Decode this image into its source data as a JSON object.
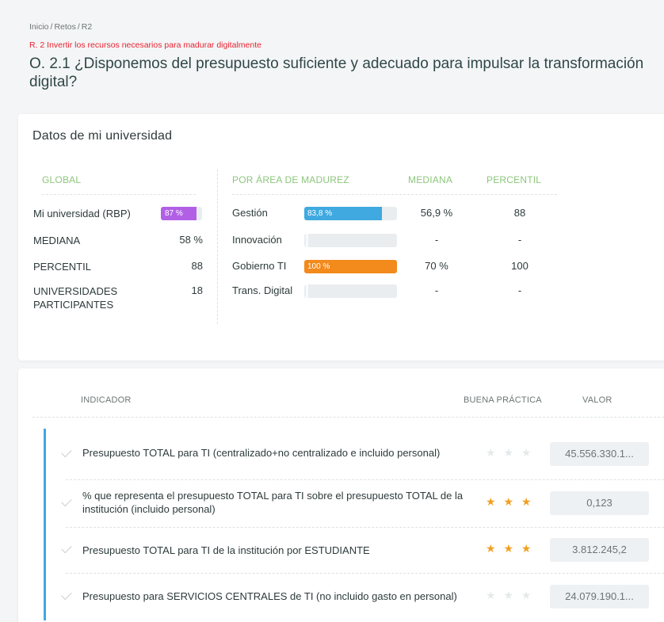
{
  "breadcrumb": {
    "items": [
      "Inicio",
      "Retos",
      "R2"
    ],
    "separator": "/"
  },
  "reto": "R. 2 Invertir los recursos necesarios para madurar digitalmente",
  "title": "O. 2.1 ¿Disponemos del presupuesto suficiente y adecuado para impulsar la transformación digital?",
  "card1": {
    "title": "Datos de mi universidad",
    "headers": {
      "global": "GLOBAL",
      "area": "POR ÁREA DE MADUREZ",
      "mediana": "MEDIANA",
      "percentil": "PERCENTIL"
    },
    "global": {
      "uni_label": "Mi universidad (RBP)",
      "uni_value": "87 %",
      "uni_fraction": 0.87,
      "mediana_label": "MEDIANA",
      "mediana_value": "58 %",
      "percentil_label": "PERCENTIL",
      "percentil_value": "88",
      "participantes_label": "UNIVERSIDADES PARTICIPANTES",
      "participantes_value": "18"
    },
    "areas": [
      {
        "label": "Gestión",
        "bar_text": "83,8 %",
        "fraction": 0.838,
        "color": "#3fa9e0",
        "mediana": "56,9 %",
        "percentil": "88"
      },
      {
        "label": "Innovación",
        "bar_text": "",
        "fraction": 0,
        "color": "#3fa9e0",
        "mediana": "-",
        "percentil": "-"
      },
      {
        "label": "Gobierno TI",
        "bar_text": "100 %",
        "fraction": 1.0,
        "color": "#f28a1c",
        "mediana": "70 %",
        "percentil": "100"
      },
      {
        "label": "Trans. Digital",
        "bar_text": "",
        "fraction": 0,
        "color": "#3fa9e0",
        "mediana": "-",
        "percentil": "-"
      }
    ]
  },
  "card2": {
    "headers": {
      "indicador": "INDICADOR",
      "buena_practica": "BUENA PRÁCTICA",
      "valor": "VALOR"
    },
    "indicators": [
      {
        "text": "Presupuesto TOTAL para TI (centralizado+no centralizado e incluido personal)",
        "good_practice": false,
        "stars": "★ ★ ★",
        "value": "45.556.330.1..."
      },
      {
        "text": "% que representa el presupuesto TOTAL para TI sobre el presupuesto TOTAL de la institución (incluido personal)",
        "good_practice": true,
        "stars": "★ ★ ★",
        "value": "0,123"
      },
      {
        "text": "Presupuesto TOTAL para TI de la institución por ESTUDIANTE",
        "good_practice": true,
        "stars": "★ ★ ★",
        "value": "3.812.245,2"
      },
      {
        "text": "Presupuesto para SERVICIOS CENTRALES de TI (no incluido gasto en personal)",
        "good_practice": false,
        "stars": "★ ★ ★",
        "value": "24.079.190.1..."
      }
    ]
  },
  "colors": {
    "accent_green": "#8cc67c",
    "accent_blue": "#3fa9e0",
    "accent_orange": "#f28a1c",
    "accent_purple": "#b160e6",
    "reto_red": "#e8232f",
    "star_gold": "#f0a020"
  }
}
